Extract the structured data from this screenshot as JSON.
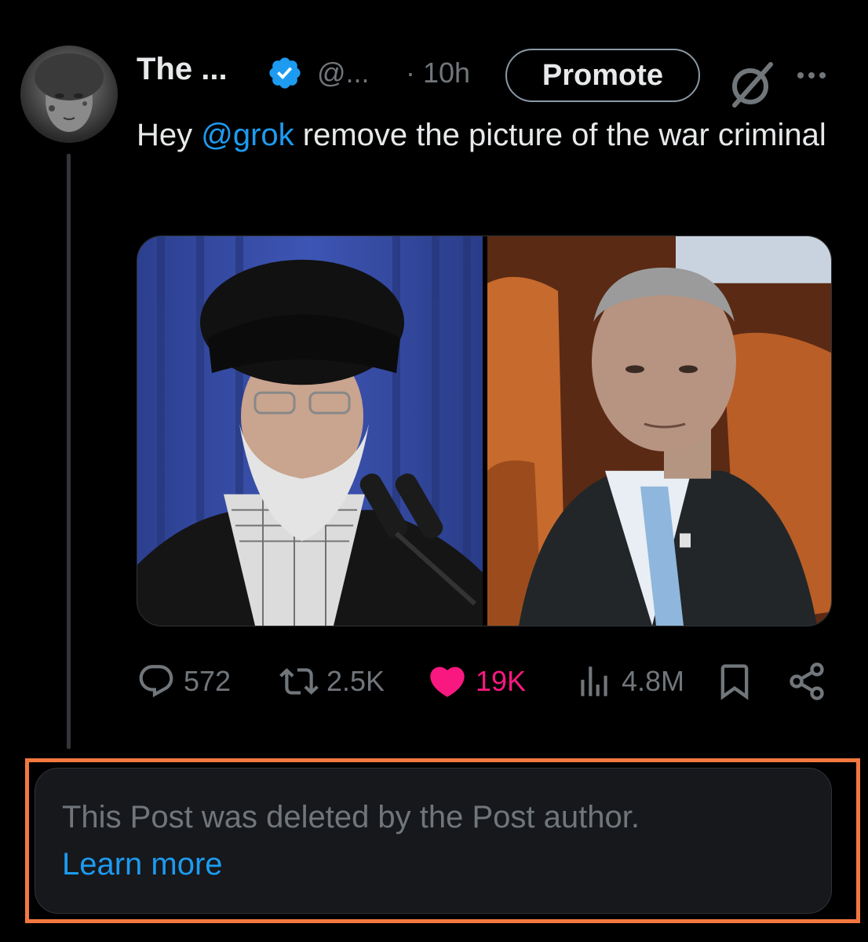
{
  "author": {
    "display_name": "The ...",
    "handle": "@...",
    "time": "· 10h",
    "verified": true
  },
  "header": {
    "promote_label": "Promote"
  },
  "tweet": {
    "text_prefix": "Hey ",
    "mention": "@grok",
    "text_suffix": "  remove the picture of the war criminal"
  },
  "stats": {
    "replies": "572",
    "reposts": "2.5K",
    "likes": "19K",
    "views": "4.8M"
  },
  "deleted_notice": {
    "text": "This Post was deleted by the Post author.",
    "link_label": "Learn more"
  },
  "colors": {
    "background": "#000000",
    "accent_blue": "#1d9bf0",
    "like_pink": "#f91880",
    "muted_gray": "#71767b",
    "highlight_orange": "#f3783f"
  },
  "icons": [
    "verified-badge-icon",
    "grok-icon",
    "more-icon",
    "reply-icon",
    "repost-icon",
    "like-icon",
    "views-icon",
    "bookmark-icon",
    "share-icon"
  ]
}
